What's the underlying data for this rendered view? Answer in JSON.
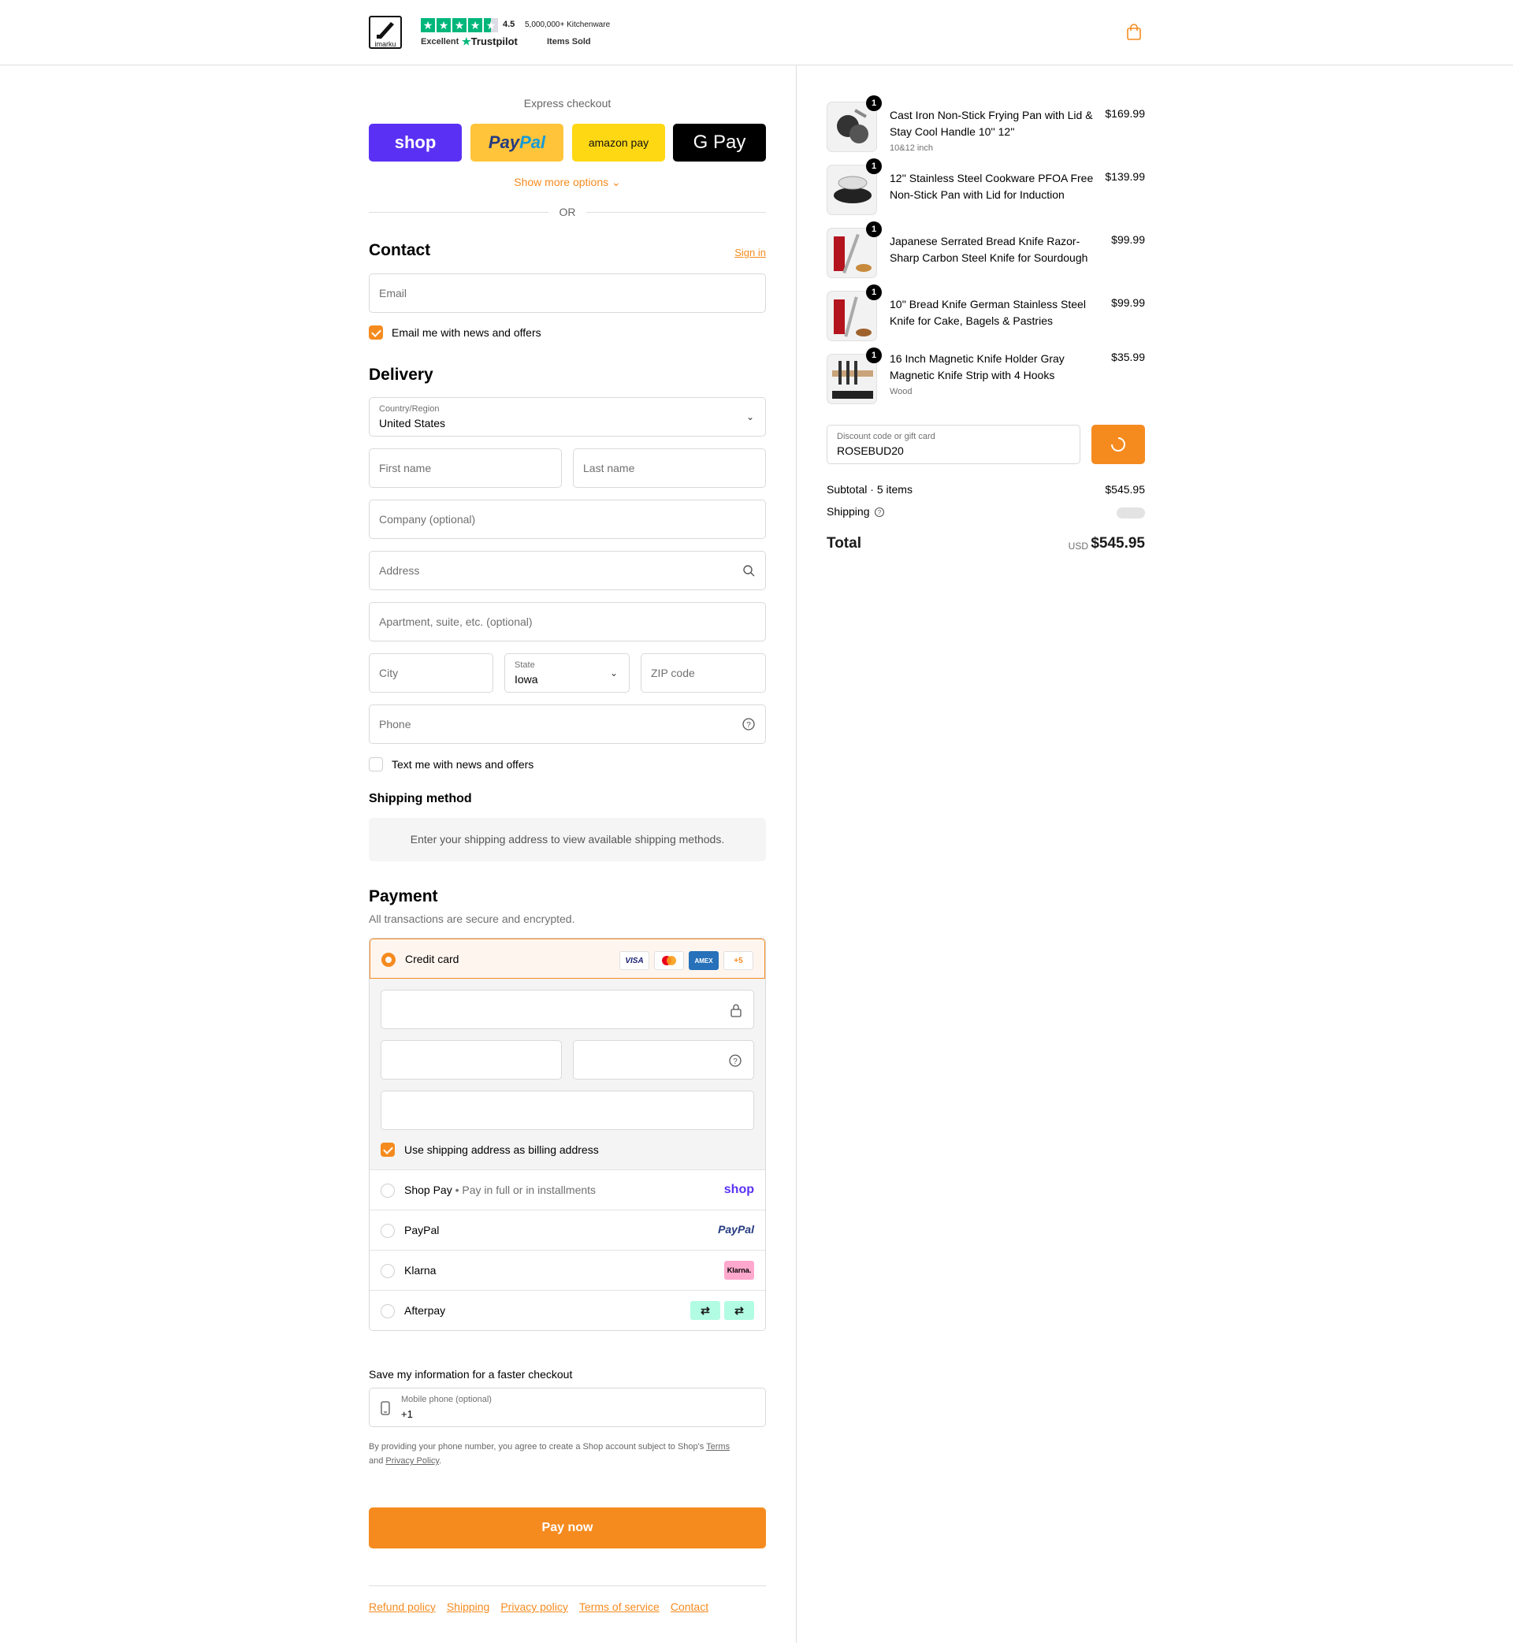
{
  "header": {
    "logo_text": "imarku",
    "trustpilot_rating": "4.5",
    "trustpilot_label": "Excellent",
    "trustpilot_brand": "Trustpilot",
    "sold_count": "5,000,000+ Kitchenware",
    "sold_label": "Items Sold",
    "cart_icon": "shopping-bag-icon"
  },
  "express": {
    "label": "Express checkout",
    "shop": "shop",
    "paypal_a": "Pay",
    "paypal_b": "Pal",
    "amazon": "amazon pay",
    "gpay": "G Pay",
    "show_more": "Show more options ⌄",
    "or": "OR"
  },
  "contact": {
    "title": "Contact",
    "sign_in": "Sign in",
    "email_placeholder": "Email",
    "email_opt_in": "Email me with news and offers"
  },
  "delivery": {
    "title": "Delivery",
    "country_label": "Country/Region",
    "country_value": "United States",
    "first_name": "First name",
    "last_name": "Last name",
    "company": "Company (optional)",
    "address": "Address",
    "apartment": "Apartment, suite, etc. (optional)",
    "city": "City",
    "state_label": "State",
    "state_value": "Iowa",
    "zip": "ZIP code",
    "phone": "Phone",
    "text_opt_in": "Text me with news and offers"
  },
  "shipping_method": {
    "title": "Shipping method",
    "message": "Enter your shipping address to view available shipping methods."
  },
  "payment": {
    "title": "Payment",
    "subtitle": "All transactions are secure and encrypted.",
    "credit_card": "Credit card",
    "card_logos": [
      "VISA",
      "MC",
      "AMEX",
      "+5"
    ],
    "billing_same": "Use shipping address as billing address",
    "shop_pay": "Shop Pay",
    "shop_pay_sub": " • Pay in full or in installments",
    "shop_logo": "shop",
    "paypal": "PayPal",
    "paypal_logo": "PayPal",
    "klarna": "Klarna",
    "klarna_logo": "Klarna.",
    "afterpay": "Afterpay",
    "accent": "#f58b1f"
  },
  "save_info": {
    "label": "Save my information for a faster checkout",
    "phone_label": "Mobile phone (optional)",
    "phone_value": "+1",
    "legal_1": "By providing your phone number, you agree to create a Shop account subject to Shop's ",
    "terms": "Terms",
    "legal_and": "and ",
    "privacy": "Privacy Policy",
    "legal_end": "."
  },
  "pay_now": "Pay now",
  "footer": [
    "Refund policy",
    "Shipping",
    "Privacy policy",
    "Terms of service",
    "Contact"
  ],
  "order": {
    "items": [
      {
        "qty": "1",
        "name": "Cast Iron Non-Stick Frying Pan with Lid & Stay Cool Handle 10'' 12''",
        "variant": "10&12 inch",
        "price": "$169.99"
      },
      {
        "qty": "1",
        "name": "12'' Stainless Steel Cookware PFOA Free Non-Stick Pan with Lid for Induction",
        "variant": "",
        "price": "$139.99"
      },
      {
        "qty": "1",
        "name": "Japanese Serrated Bread Knife Razor-Sharp Carbon Steel Knife for Sourdough",
        "variant": "",
        "price": "$99.99"
      },
      {
        "qty": "1",
        "name": "10'' Bread Knife German Stainless Steel Knife for Cake, Bagels & Pastries",
        "variant": "",
        "price": "$99.99"
      },
      {
        "qty": "1",
        "name": "16 Inch Magnetic Knife Holder Gray Magnetic Knife Strip with 4 Hooks",
        "variant": "Wood",
        "price": "$35.99"
      }
    ],
    "discount_label": "Discount code or gift card",
    "discount_value": "ROSEBUD20",
    "subtotal_label": "Subtotal · 5 items",
    "subtotal_value": "$545.95",
    "shipping_label": "Shipping",
    "total_label": "Total",
    "currency": "USD",
    "total_value": "$545.95"
  }
}
